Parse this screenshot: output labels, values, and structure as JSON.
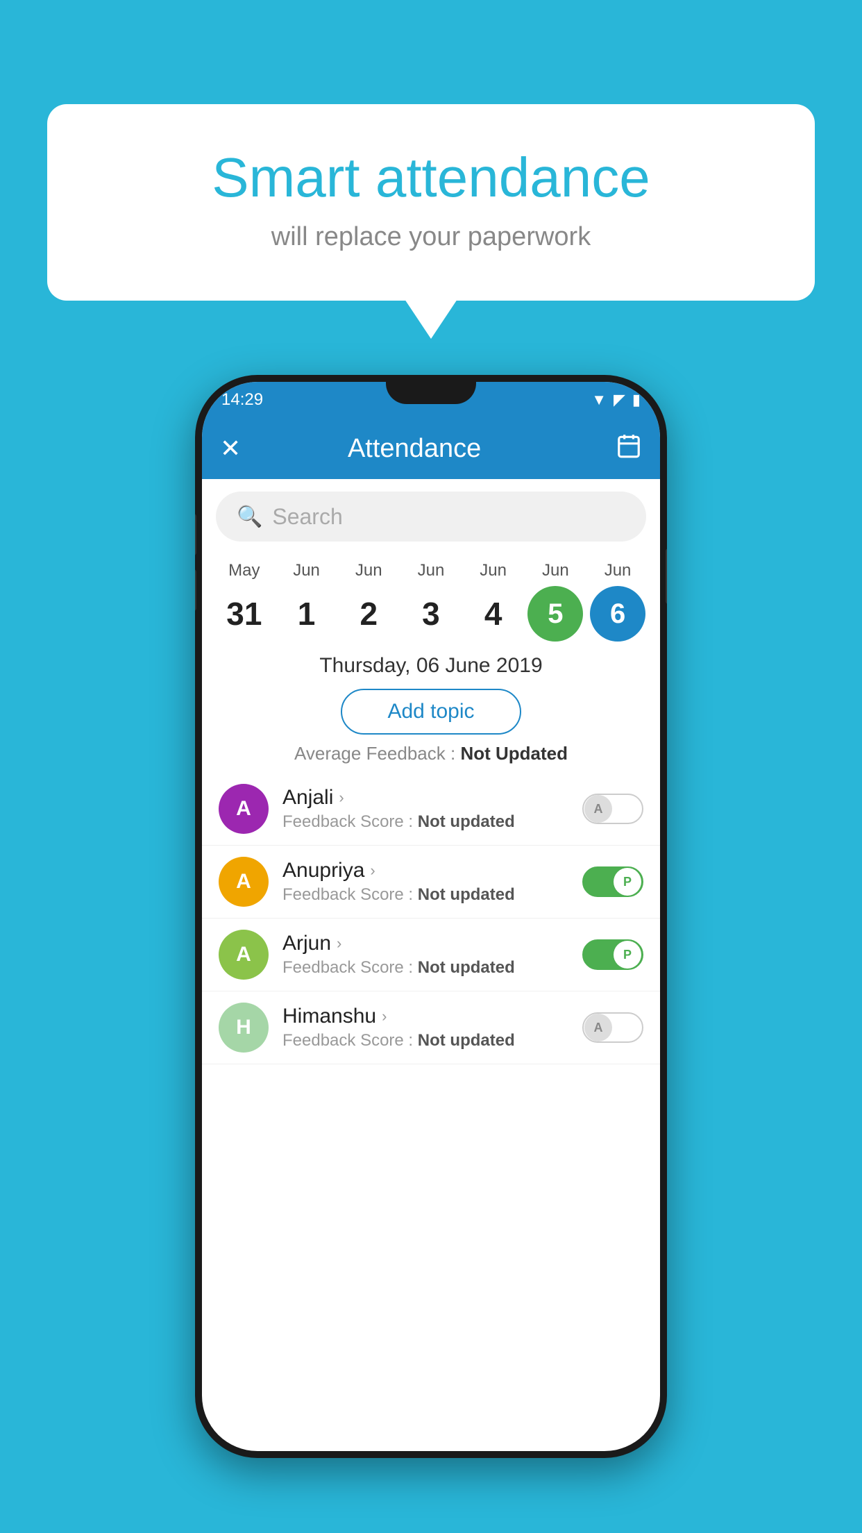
{
  "background_color": "#29b6d8",
  "speech_bubble": {
    "title": "Smart attendance",
    "subtitle": "will replace your paperwork"
  },
  "status_bar": {
    "time": "14:29",
    "icons": [
      "wifi",
      "signal",
      "battery"
    ]
  },
  "app_header": {
    "close_label": "✕",
    "title": "Attendance",
    "calendar_icon": "📅"
  },
  "search": {
    "placeholder": "Search"
  },
  "calendar": {
    "days": [
      {
        "month": "May",
        "date": "31",
        "state": "normal"
      },
      {
        "month": "Jun",
        "date": "1",
        "state": "normal"
      },
      {
        "month": "Jun",
        "date": "2",
        "state": "normal"
      },
      {
        "month": "Jun",
        "date": "3",
        "state": "normal"
      },
      {
        "month": "Jun",
        "date": "4",
        "state": "normal"
      },
      {
        "month": "Jun",
        "date": "5",
        "state": "today"
      },
      {
        "month": "Jun",
        "date": "6",
        "state": "selected"
      }
    ]
  },
  "selected_date": "Thursday, 06 June 2019",
  "add_topic_label": "Add topic",
  "average_feedback": {
    "label": "Average Feedback :",
    "value": "Not Updated"
  },
  "students": [
    {
      "name": "Anjali",
      "initial": "A",
      "avatar_color": "#9c27b0",
      "feedback_label": "Feedback Score :",
      "feedback_value": "Not updated",
      "attendance": "absent"
    },
    {
      "name": "Anupriya",
      "initial": "A",
      "avatar_color": "#f0a500",
      "feedback_label": "Feedback Score :",
      "feedback_value": "Not updated",
      "attendance": "present"
    },
    {
      "name": "Arjun",
      "initial": "A",
      "avatar_color": "#8bc34a",
      "feedback_label": "Feedback Score :",
      "feedback_value": "Not updated",
      "attendance": "present"
    },
    {
      "name": "Himanshu",
      "initial": "H",
      "avatar_color": "#a5d6a7",
      "feedback_label": "Feedback Score :",
      "feedback_value": "Not updated",
      "attendance": "absent"
    }
  ],
  "toggle_labels": {
    "absent": "A",
    "present": "P"
  }
}
